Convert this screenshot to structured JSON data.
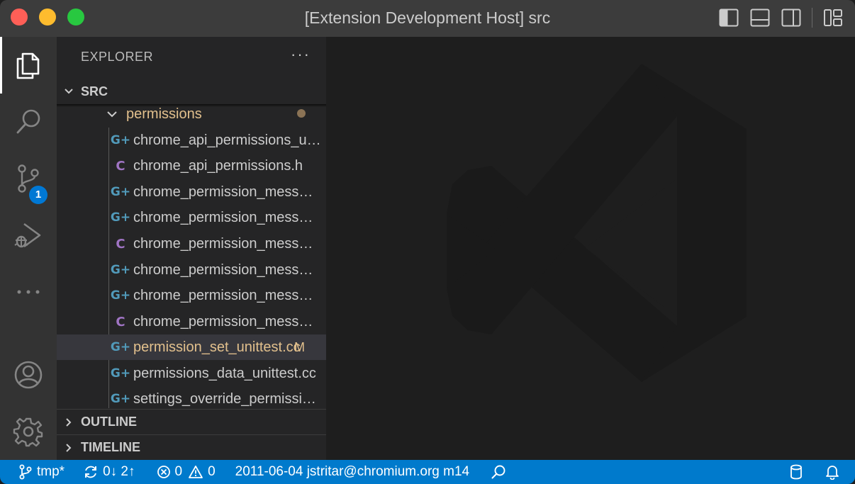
{
  "window": {
    "title": "[Extension Development Host] src"
  },
  "activity_bar": {
    "items": [
      {
        "name": "explorer",
        "icon": "files-icon"
      },
      {
        "name": "search",
        "icon": "search-icon"
      },
      {
        "name": "source-control",
        "icon": "source-control-icon",
        "badge": "1"
      },
      {
        "name": "run-and-debug",
        "icon": "run-debug-icon"
      },
      {
        "name": "more",
        "icon": "ellipsis-icon"
      }
    ],
    "bottom": [
      {
        "name": "accounts",
        "icon": "account-icon"
      },
      {
        "name": "manage",
        "icon": "gear-icon"
      }
    ]
  },
  "sidebar": {
    "title": "EXPLORER",
    "more": "···",
    "root": "SRC",
    "folder": "permissions",
    "files": [
      {
        "label": "chrome_api_permissions_unittest.cc",
        "type": "cpp"
      },
      {
        "label": "chrome_api_permissions.h",
        "type": "c"
      },
      {
        "label": "chrome_permission_message_provider.cc",
        "type": "cpp"
      },
      {
        "label": "chrome_permission_message_rules.cc",
        "type": "cpp"
      },
      {
        "label": "chrome_permission_message_rules.h",
        "type": "c"
      },
      {
        "label": "chrome_permission_message_unittest.cc",
        "type": "cpp"
      },
      {
        "label": "chrome_permission_message_provider_unittest.cc",
        "type": "cpp"
      },
      {
        "label": "chrome_permission_message_provider.h",
        "type": "c"
      },
      {
        "label": "permission_set_unittest.cc",
        "type": "cpp",
        "status": "M",
        "selected": true
      },
      {
        "label": "permissions_data_unittest.cc",
        "type": "cpp"
      },
      {
        "label": "settings_override_permission_unittest.cc",
        "type": "cpp"
      }
    ],
    "sections": {
      "outline": "OUTLINE",
      "timeline": "TIMELINE"
    }
  },
  "status_bar": {
    "branch": "tmp*",
    "sync": "0↓ 2↑",
    "errors": "0",
    "warnings": "0",
    "blame": "2011-06-04 jstritar@chromium.org m14"
  },
  "colors": {
    "status_bar": "#007acc",
    "folder_text": "#e2c08d",
    "cpp_icon": "#519aba",
    "c_icon": "#a074c4",
    "badge": "#0078d4"
  }
}
